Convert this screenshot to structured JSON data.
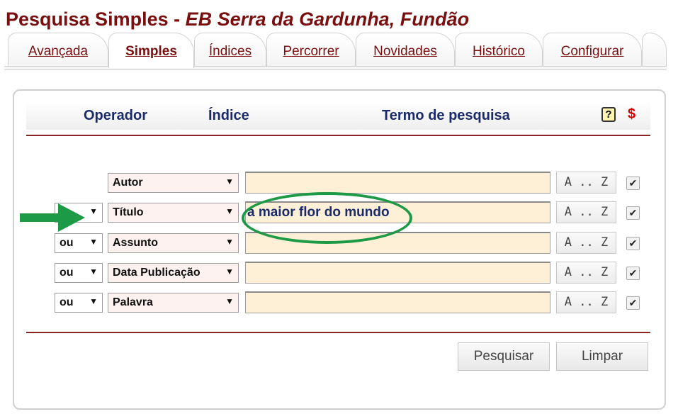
{
  "page": {
    "title_main": "Pesquisa Simples - ",
    "title_library": "EB Serra da Gardunha, Fundão"
  },
  "tabs": [
    {
      "label": "Avançada",
      "active": false
    },
    {
      "label": "Simples",
      "active": true
    },
    {
      "label": "Índices",
      "active": false
    },
    {
      "label": "Percorrer",
      "active": false
    },
    {
      "label": "Novidades",
      "active": false
    },
    {
      "label": "Histórico",
      "active": false
    },
    {
      "label": "Configurar",
      "active": false
    }
  ],
  "header": {
    "operator": "Operador",
    "index": "Índice",
    "term": "Termo de pesquisa",
    "help_icon": "?",
    "dollar_icon": "$"
  },
  "rows": [
    {
      "operator": "",
      "index": "Autor",
      "term": "",
      "browse": "A .. Z",
      "checked": true
    },
    {
      "operator": "",
      "index": "Título",
      "term": "a maior flor do mundo",
      "browse": "A .. Z",
      "checked": true
    },
    {
      "operator": "ou",
      "index": "Assunto",
      "term": "",
      "browse": "A .. Z",
      "checked": true
    },
    {
      "operator": "ou",
      "index": "Data Publicação",
      "term": "",
      "browse": "A .. Z",
      "checked": true
    },
    {
      "operator": "ou",
      "index": "Palavra",
      "term": "",
      "browse": "A .. Z",
      "checked": true
    }
  ],
  "buttons": {
    "search": "Pesquisar",
    "clear": "Limpar"
  },
  "glyphs": {
    "dropdown": "▼",
    "check": "✔"
  },
  "colors": {
    "brand": "#7a0f10",
    "header_text": "#1a2a6c",
    "term_background": "#fdf0d6",
    "annotation": "#1d9a46"
  }
}
